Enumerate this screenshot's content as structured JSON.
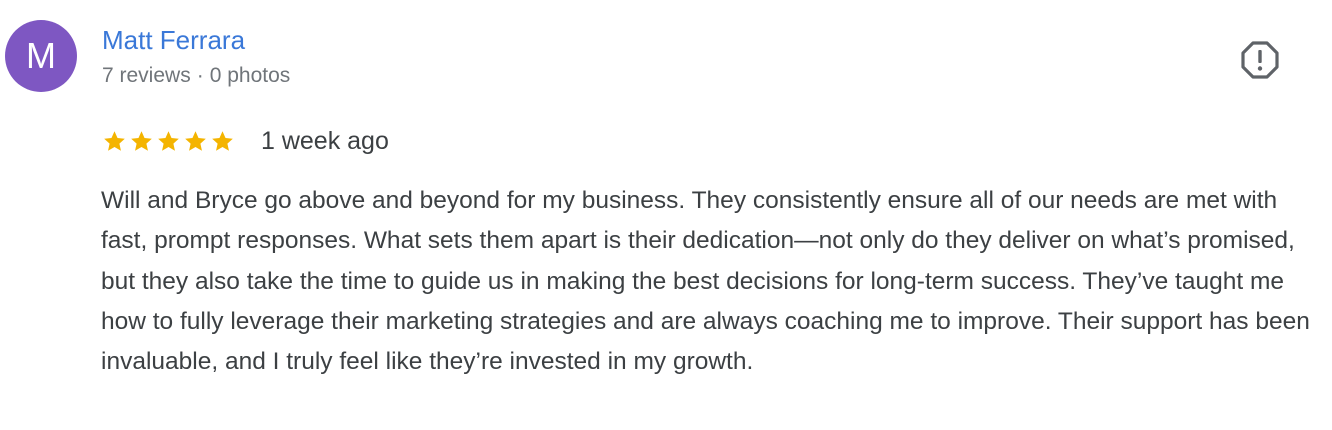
{
  "review": {
    "author": {
      "initial": "M",
      "name": "Matt Ferrara",
      "reviews_count": "7 reviews",
      "separator": "·",
      "photos_count": "0 photos",
      "avatar_color": "#7e57c2"
    },
    "rating": {
      "value": 5,
      "max": 5,
      "star_color": "#f4b400"
    },
    "date": "1 week ago",
    "text": "Will and Bryce go above and beyond for my business. They consistently ensure all of our needs are met with fast, prompt responses. What sets them apart is their dedication—not only do they deliver on what’s promised, but they also take the time to guide us in making the best decisions for long-term success. They’ve taught me how to fully leverage their marketing strategies and are always coaching me to improve. Their support has been invaluable, and I truly feel like they’re invested in my growth.",
    "report_icon": "report-icon",
    "name_color": "#3a78d8"
  }
}
